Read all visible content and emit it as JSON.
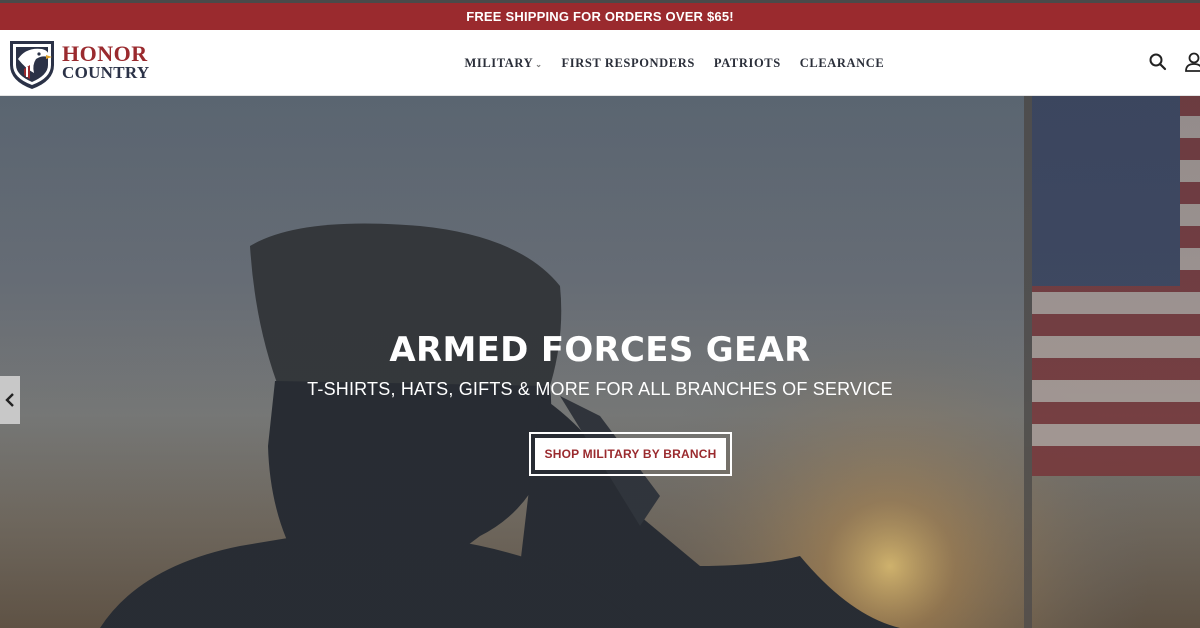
{
  "announcement": {
    "text": "FREE SHIPPING FOR ORDERS OVER $65!"
  },
  "brand": {
    "line1": "HONOR",
    "line2": "COUNTRY",
    "logo_icon": "eagle-shield-icon"
  },
  "nav": {
    "items": [
      {
        "label": "MILITARY",
        "has_dropdown": true
      },
      {
        "label": "FIRST RESPONDERS"
      },
      {
        "label": "PATRIOTS"
      },
      {
        "label": "CLEARANCE"
      }
    ]
  },
  "header_icons": {
    "search": "search-icon",
    "account": "user-icon"
  },
  "hero": {
    "title": "ARMED FORCES GEAR",
    "subtitle": "T-SHIRTS, HATS, GIFTS & MORE FOR ALL BRANCHES OF SERVICE",
    "cta_label": "SHOP MILITARY BY BRANCH",
    "prev_icon": "chevron-left-icon"
  },
  "colors": {
    "brand_red": "#9a2a2e",
    "navy": "#2b3247",
    "white": "#ffffff"
  }
}
